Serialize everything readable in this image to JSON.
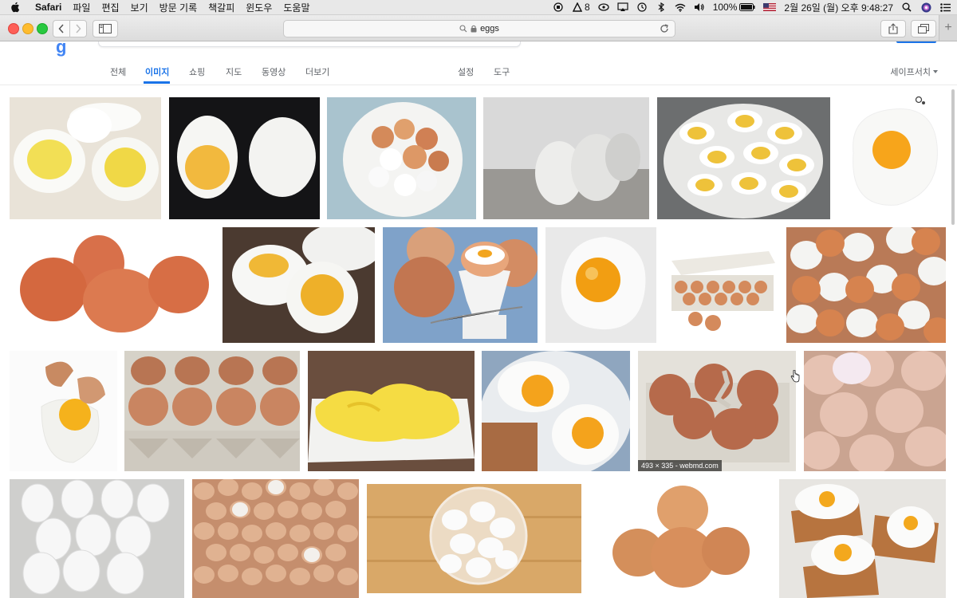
{
  "menubar": {
    "app_name": "Safari",
    "items": [
      "파일",
      "편집",
      "보기",
      "방문 기록",
      "책갈피",
      "윈도우",
      "도움말"
    ],
    "status": {
      "adobe_count": "8",
      "battery": "100%",
      "datetime": "2월 26일 (월) 오후 9:48:27"
    }
  },
  "toolbar": {
    "address_text": "eggs"
  },
  "google": {
    "tabs": [
      "전체",
      "이미지",
      "쇼핑",
      "지도",
      "동영상",
      "더보기"
    ],
    "active_tab": "이미지",
    "tools": [
      "설정",
      "도구"
    ],
    "safesearch": "세이프서치",
    "accent_color": "#1a73e8"
  },
  "images": [
    {
      "name": "boiled-eggs-halved"
    },
    {
      "name": "halved-egg-dark"
    },
    {
      "name": "eggs-in-bowl"
    },
    {
      "name": "white-eggs-wood"
    },
    {
      "name": "deviled-eggs-plate"
    },
    {
      "name": "fried-egg-white"
    },
    {
      "name": "brown-eggs-three"
    },
    {
      "name": "boiled-eggs-wood"
    },
    {
      "name": "egg-in-cup"
    },
    {
      "name": "fried-egg-single"
    },
    {
      "name": "egg-carton-white"
    },
    {
      "name": "mixed-eggs-pile"
    },
    {
      "name": "cracked-egg"
    },
    {
      "name": "brown-eggs-carton"
    },
    {
      "name": "scrambled-eggs"
    },
    {
      "name": "fried-eggs-toast"
    },
    {
      "name": "brown-eggs-box",
      "caption": "493 × 335 - webmd.com"
    },
    {
      "name": "pink-eggs"
    },
    {
      "name": "white-eggs-crate"
    },
    {
      "name": "brown-eggs-many"
    },
    {
      "name": "eggs-glass-bowl"
    },
    {
      "name": "brown-eggs-stack"
    },
    {
      "name": "cloud-eggs-toast"
    }
  ]
}
